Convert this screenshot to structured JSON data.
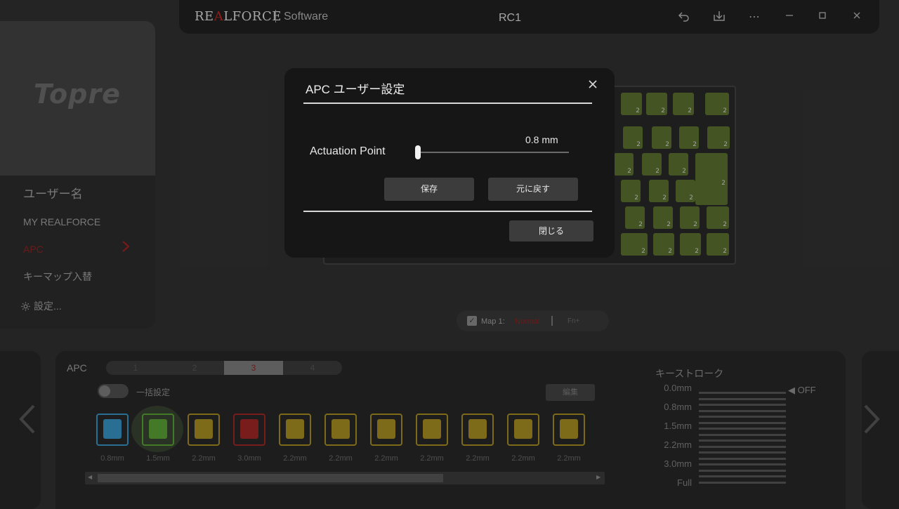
{
  "titlebar": {
    "brand_pre": "RE",
    "brand_accent": "A",
    "brand_post": "LFORCE",
    "software": "Software",
    "model": "RC1",
    "icons": [
      "undo-icon",
      "download-icon",
      "more-icon",
      "minimize-icon",
      "maximize-icon",
      "close-icon"
    ]
  },
  "sidebar": {
    "logo": "Topre",
    "user_name": "ユーザー名",
    "items": [
      {
        "label": "MY REALFORCE"
      },
      {
        "label": "APC"
      },
      {
        "label": "キーマップ入替"
      },
      {
        "label": "設定..."
      }
    ]
  },
  "map_bar": {
    "label": "Map 1:",
    "normal": "Normal",
    "fn": "Fn+"
  },
  "apc_panel": {
    "title": "APC",
    "tabs": [
      "1",
      "2",
      "3",
      "4"
    ],
    "active_tab": "3",
    "toggle_label": "一括設定",
    "edit_label": "編集",
    "swatches": [
      {
        "label": "0.8mm",
        "color": "#2f7fa8"
      },
      {
        "label": "1.5mm",
        "color": "#4e8a2e"
      },
      {
        "label": "2.2mm",
        "color": "#8f7a1e"
      },
      {
        "label": "3.0mm",
        "color": "#8a2020"
      },
      {
        "label": "2.2mm",
        "color": "#8f7a1e"
      },
      {
        "label": "2.2mm",
        "color": "#8f7a1e"
      },
      {
        "label": "2.2mm",
        "color": "#8f7a1e"
      },
      {
        "label": "2.2mm",
        "color": "#8f7a1e"
      },
      {
        "label": "2.2mm",
        "color": "#8f7a1e"
      },
      {
        "label": "2.2mm",
        "color": "#8f7a1e"
      },
      {
        "label": "2.2mm",
        "color": "#8f7a1e"
      }
    ]
  },
  "stroke_panel": {
    "title": "キーストローク",
    "labels": [
      "0.0mm",
      "0.8mm",
      "1.5mm",
      "2.2mm",
      "3.0mm",
      "Full"
    ],
    "off_label": "OFF"
  },
  "modal": {
    "title": "APC ユーザー設定",
    "close_icon": "close-icon",
    "actuation_label": "Actuation Point",
    "actuation_value": "0.8 mm",
    "save_label": "保存",
    "revert_label": "元に戻す",
    "close_label": "閉じる"
  }
}
